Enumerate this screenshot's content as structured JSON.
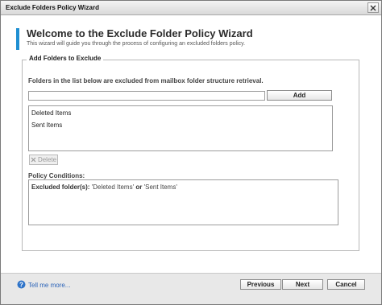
{
  "window": {
    "title": "Exclude Folders Policy Wizard",
    "close_icon": "close-icon"
  },
  "header": {
    "title": "Welcome to the Exclude Folder Policy Wizard",
    "subtitle": "This wizard will guide you through the process of configuring an excluded folders policy.",
    "accent_color": "#1f8fd2"
  },
  "group": {
    "legend": "Add Folders to Exclude",
    "instructions": "Folders in the list below are excluded from mailbox folder structure retrieval.",
    "folder_input": {
      "value": "",
      "placeholder": ""
    },
    "add_label": "Add",
    "folders": [
      {
        "label": "Deleted Items"
      },
      {
        "label": "Sent Items"
      }
    ],
    "delete_label": "Delete",
    "policy_conditions_label": "Policy Conditions:",
    "policy_line": {
      "prefix": "Excluded folder(s):",
      "item1": "'Deleted Items'",
      "connector": "or",
      "item2": "'Sent Items'"
    }
  },
  "footer": {
    "help_label": "Tell me more...",
    "help_icon": "help-icon",
    "previous_label": "Previous",
    "next_label": "Next",
    "cancel_label": "Cancel",
    "link_color": "#2b63b8"
  }
}
